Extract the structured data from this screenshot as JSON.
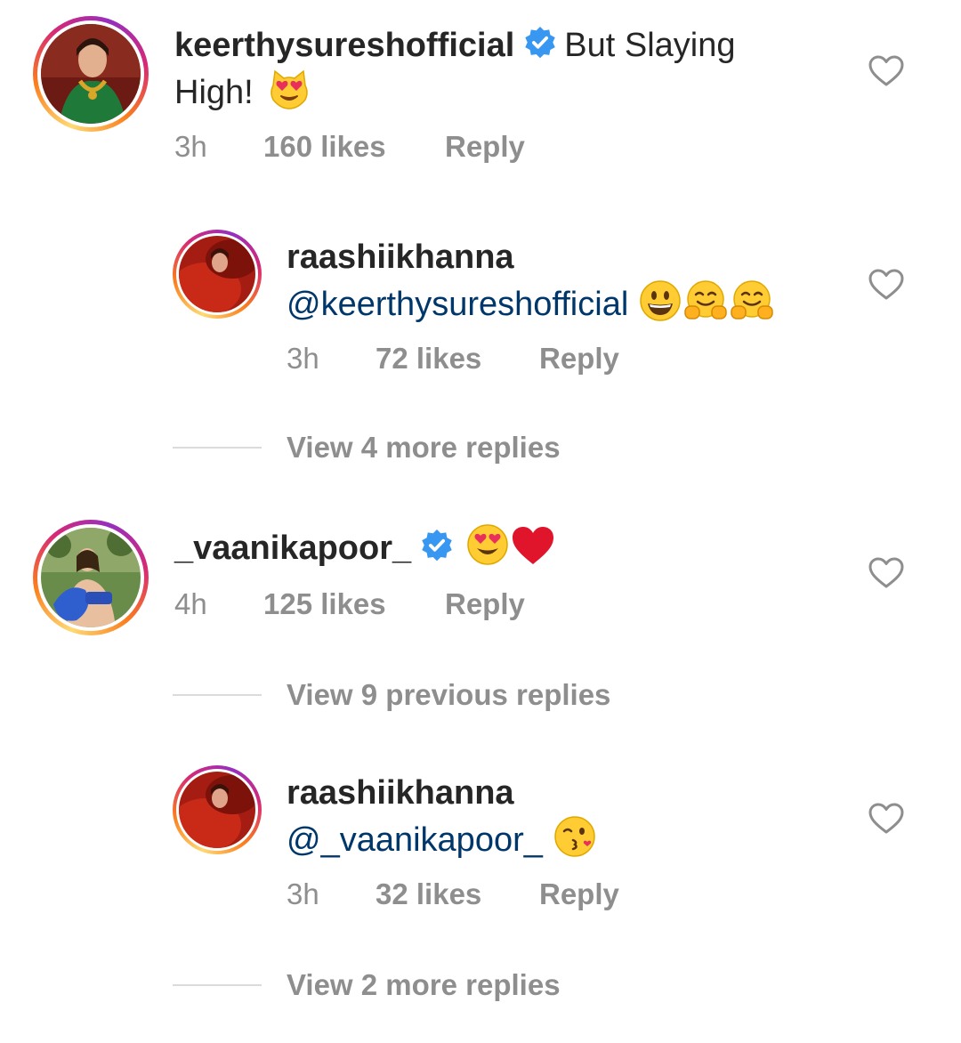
{
  "comments": [
    {
      "username": "keerthysureshofficial",
      "verified": true,
      "text_inline": "But Slaying",
      "text_line2": "High!",
      "emoji": "heart-eyes-cat",
      "time": "3h",
      "likes": "160 likes",
      "reply": "Reply"
    },
    {
      "username": "raashiikhanna",
      "mention": "@keerthysureshofficial",
      "emojis": [
        "grinning-face",
        "hugging-face",
        "hugging-face"
      ],
      "time": "3h",
      "likes": "72 likes",
      "reply": "Reply",
      "view_more": "View 4 more replies"
    },
    {
      "username": "_vaanikapoor_",
      "verified": true,
      "emojis": [
        "heart-eyes-face",
        "red-heart"
      ],
      "time": "4h",
      "likes": "125 likes",
      "reply": "Reply",
      "view_more": "View 9 previous replies"
    },
    {
      "username": "raashiikhanna",
      "mention": "@_vaanikapoor_",
      "emojis": [
        "kissing-face"
      ],
      "time": "3h",
      "likes": "32 likes",
      "reply": "Reply",
      "view_more": "View 2 more replies"
    }
  ],
  "colors": {
    "text": "#262626",
    "muted": "#8e8e8e",
    "mention": "#00376b",
    "verified": "#3897f0",
    "divider": "#dbdbdb"
  }
}
